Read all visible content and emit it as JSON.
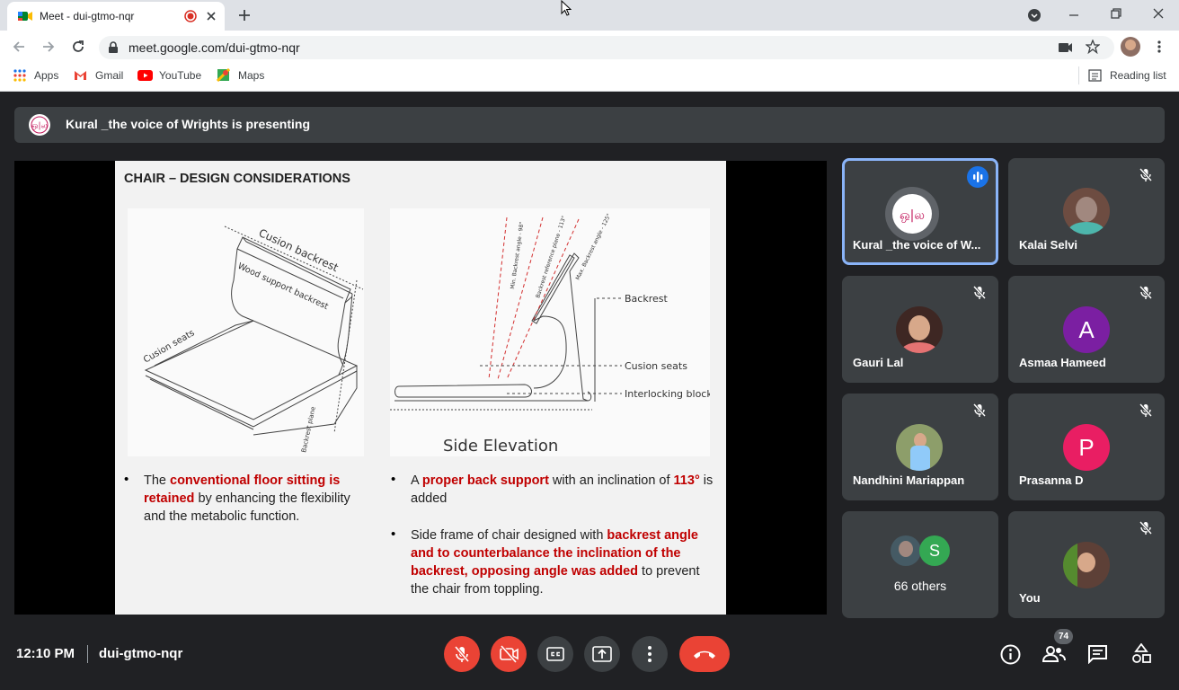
{
  "browser": {
    "tab_title": "Meet - dui-gtmo-nqr",
    "url": "meet.google.com/dui-gtmo-nqr",
    "bookmarks": [
      "Apps",
      "Gmail",
      "YouTube",
      "Maps"
    ],
    "reading_list": "Reading list"
  },
  "meet": {
    "presenting_text": "Kural _the voice of Wrights is presenting",
    "time": "12:10 PM",
    "meeting_code": "dui-gtmo-nqr",
    "people_count": "74",
    "colors": {
      "end_call": "#ea4335",
      "accent": "#1a73e8"
    }
  },
  "slide": {
    "title": "CHAIR – DESIGN CONSIDERATIONS",
    "fig_left_labels": [
      "Cusion backrest",
      "Wood support backrest",
      "Cusion seats",
      "Backrest plane"
    ],
    "fig_right_labels": [
      "Min. Backrest angle - 98°",
      "Backrest reference plane - 113°",
      "Max. Backrest angle - 125°",
      "Backrest",
      "Cusion seats",
      "Interlocking blocks"
    ],
    "fig_caption": "Side Elevation",
    "bullet1": {
      "pre": "The ",
      "em": "conventional floor sitting is retained",
      "post": " by enhancing the flexibility and the metabolic function."
    },
    "bullet2": {
      "pre": "A ",
      "em1": "proper back support",
      "mid": " with an inclination of ",
      "em2": "113°",
      "post": " is added"
    },
    "bullet3": {
      "pre": "Side frame of chair designed with ",
      "em": "backrest angle and to counterbalance the inclination of the backrest, opposing angle was added",
      "post": " to prevent the chair from toppling."
    }
  },
  "participants": [
    {
      "name": "Kural _the voice of W...",
      "letter": ""
    },
    {
      "name": "Kalai Selvi",
      "letter": ""
    },
    {
      "name": "Gauri Lal",
      "letter": ""
    },
    {
      "name": "Asmaa Hameed",
      "letter": "A",
      "color": "#7b1fa2"
    },
    {
      "name": "Nandhini Mariappan",
      "letter": ""
    },
    {
      "name": "Prasanna D",
      "letter": "P",
      "color": "#e91e63"
    },
    {
      "name": "66 others",
      "letter": "S",
      "color": "#34a853"
    },
    {
      "name": "You",
      "letter": ""
    }
  ]
}
